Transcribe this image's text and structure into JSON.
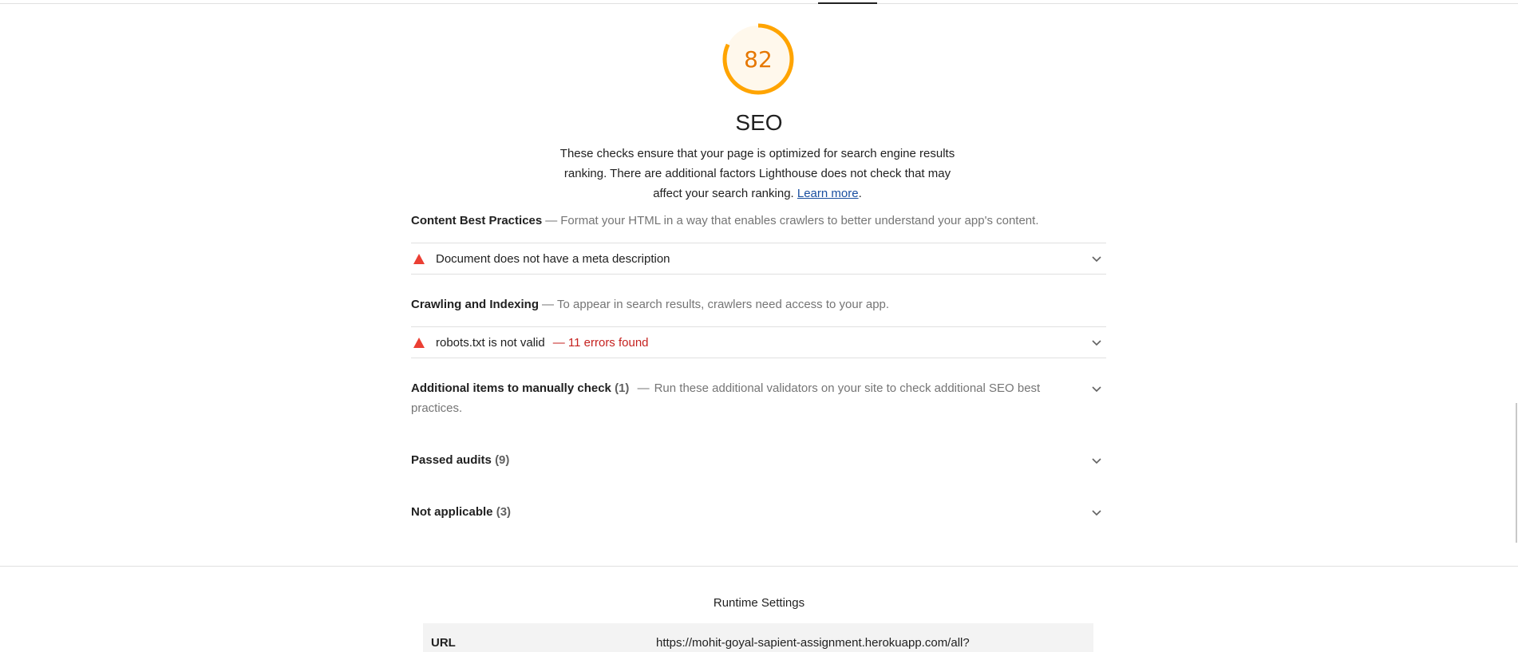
{
  "category": {
    "score": "82",
    "title": "SEO",
    "description": "These checks ensure that your page is optimized for search engine results ranking. There are additional factors Lighthouse does not check that may affect your search ranking.",
    "learn_more": "Learn more",
    "score_fraction": 0.82,
    "score_color": "#ffa400"
  },
  "groups": [
    {
      "title": "Content Best Practices",
      "description": "Format your HTML in a way that enables crawlers to better understand your app's content.",
      "audits": [
        {
          "title": "Document does not have a meta description",
          "extra": ""
        }
      ]
    },
    {
      "title": "Crawling and Indexing",
      "description": "To appear in search results, crawlers need access to your app.",
      "audits": [
        {
          "title": "robots.txt is not valid",
          "extra": "— 11 errors found"
        }
      ]
    }
  ],
  "manual": {
    "title": "Additional items to manually check",
    "count": "(1)",
    "description": "Run these additional validators on your site to check additional SEO best practices."
  },
  "passed": {
    "title": "Passed audits",
    "count": "(9)"
  },
  "not_applicable": {
    "title": "Not applicable",
    "count": "(3)"
  },
  "runtime": {
    "title": "Runtime Settings",
    "rows": [
      {
        "key": "URL",
        "value": "https://mohit-goyal-sapient-assignment.herokuapp.com/all?"
      }
    ]
  },
  "dash": "—"
}
